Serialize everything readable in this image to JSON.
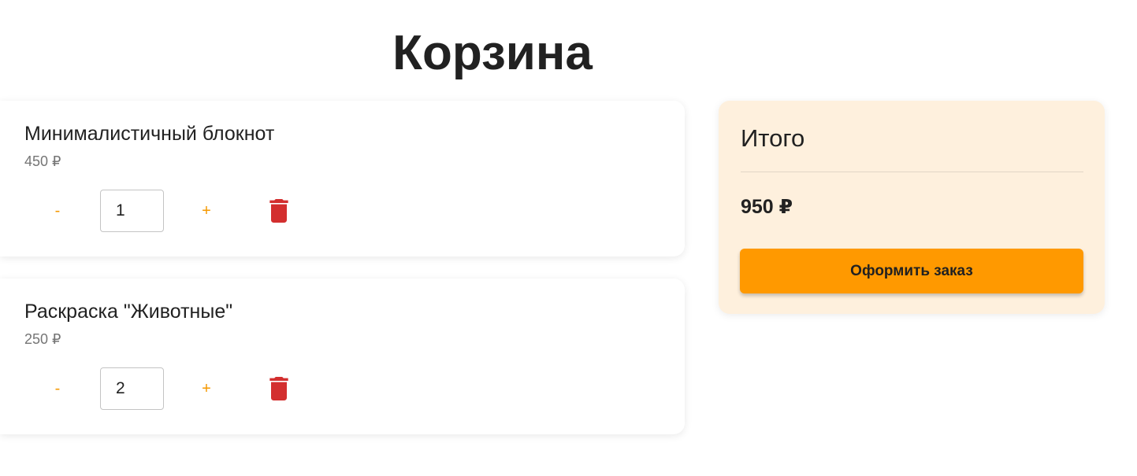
{
  "page": {
    "title": "Корзина"
  },
  "cart": {
    "items": [
      {
        "name": "Минималистичный блокнот",
        "price": "450 ₽",
        "decrement_label": "-",
        "quantity": "1",
        "increment_label": "+",
        "delete_icon": "trash-icon"
      },
      {
        "name": "Раскраска \"Животные\"",
        "price": "250 ₽",
        "decrement_label": "-",
        "quantity": "2",
        "increment_label": "+",
        "delete_icon": "trash-icon"
      }
    ]
  },
  "summary": {
    "title": "Итого",
    "total": "950 ₽",
    "checkout_label": "Оформить заказ"
  },
  "colors": {
    "accent": "#ff9900",
    "qty_button": "#f59800",
    "delete": "#d32f2f",
    "summary_background": "#fef0dd"
  }
}
